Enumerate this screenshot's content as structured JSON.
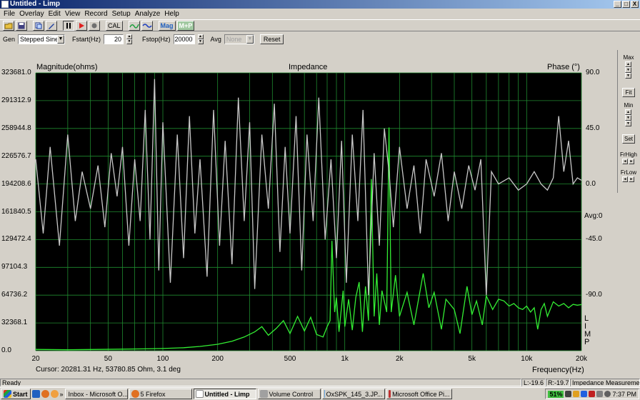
{
  "window": {
    "title": "Untitled - Limp",
    "min": "_",
    "max": "□",
    "close": "X"
  },
  "menu": [
    "File",
    "Overlay",
    "Edit",
    "View",
    "Record",
    "Setup",
    "Analyze",
    "Help"
  ],
  "toolbar": {
    "cal_label": "CAL",
    "mag_label": "Mag",
    "mp_label": "M+P"
  },
  "controls": {
    "gen_label": "Gen",
    "gen_value": "Stepped Sine",
    "fstart_label": "Fstart(Hz)",
    "fstart_value": "20",
    "fstop_label": "Fstop(Hz)",
    "fstop_value": "20000",
    "avg_label": "Avg",
    "avg_value": "None",
    "reset_label": "Reset"
  },
  "plot": {
    "title": "Impedance",
    "left_axis_label": "Magnitude(ohms)",
    "right_axis_label": "Phase (°)",
    "x_axis_label": "Frequency(Hz)",
    "cursor_text": "Cursor: 20281.31 Hz, 53780.85 Ohm, 3.1 deg",
    "avg_text": "Avg:0",
    "side_letters": [
      "L",
      "I",
      "M",
      "P"
    ]
  },
  "chart_data": {
    "type": "line",
    "title": "Impedance",
    "xlabel": "Frequency(Hz)",
    "ylabel": "Magnitude(ohms)",
    "y2label": "Phase (°)",
    "x_scale": "log",
    "xlim": [
      20,
      20000
    ],
    "ylim": [
      0,
      323681
    ],
    "y2lim": [
      -135,
      90
    ],
    "x_ticks": [
      "20",
      "50",
      "100",
      "200",
      "500",
      "1k",
      "2k",
      "5k",
      "10k",
      "20k"
    ],
    "x_tick_values": [
      20,
      50,
      100,
      200,
      500,
      1000,
      2000,
      5000,
      10000,
      20000
    ],
    "y_ticks": [
      "0.0",
      "32368.1",
      "64736.2",
      "97104.3",
      "129472.4",
      "161840.5",
      "194208.6",
      "226576.7",
      "258944.8",
      "291312.9",
      "323681.0"
    ],
    "y2_ticks": [
      "90.0",
      "45.0",
      "0.0",
      "-45.0",
      "-90.0"
    ],
    "y2_tick_values": [
      90,
      45,
      0,
      -45,
      -90
    ],
    "grid": true,
    "background": "#000000",
    "series": [
      {
        "axis": "left",
        "color": "#33ee33",
        "points": [
          [
            20,
            1500
          ],
          [
            30,
            1200
          ],
          [
            40,
            1400
          ],
          [
            60,
            1800
          ],
          [
            80,
            2200
          ],
          [
            100,
            2600
          ],
          [
            130,
            3500
          ],
          [
            160,
            5000
          ],
          [
            200,
            7500
          ],
          [
            240,
            11000
          ],
          [
            280,
            16000
          ],
          [
            320,
            22000
          ],
          [
            350,
            28000
          ],
          [
            380,
            18000
          ],
          [
            420,
            26000
          ],
          [
            460,
            35000
          ],
          [
            500,
            20000
          ],
          [
            550,
            40000
          ],
          [
            600,
            23000
          ],
          [
            650,
            39000
          ],
          [
            700,
            19000
          ],
          [
            760,
            16000
          ],
          [
            800,
            28000
          ],
          [
            830,
            35000
          ],
          [
            850,
            128000
          ],
          [
            880,
            45000
          ],
          [
            900,
            62000
          ],
          [
            930,
            22000
          ],
          [
            980,
            70000
          ],
          [
            1000,
            28000
          ],
          [
            1050,
            60000
          ],
          [
            1100,
            24000
          ],
          [
            1150,
            62000
          ],
          [
            1200,
            80000
          ],
          [
            1250,
            22000
          ],
          [
            1300,
            75000
          ],
          [
            1350,
            35000
          ],
          [
            1400,
            200000
          ],
          [
            1450,
            40000
          ],
          [
            1500,
            90000
          ],
          [
            1550,
            30000
          ],
          [
            1600,
            70000
          ],
          [
            1700,
            45000
          ],
          [
            1750,
            260000
          ],
          [
            1800,
            45000
          ],
          [
            1900,
            88000
          ],
          [
            2000,
            40000
          ],
          [
            2200,
            68000
          ],
          [
            2400,
            30000
          ],
          [
            2700,
            90000
          ],
          [
            2900,
            50000
          ],
          [
            3100,
            68000
          ],
          [
            3400,
            25000
          ],
          [
            3600,
            60000
          ],
          [
            4000,
            48000
          ],
          [
            4300,
            20000
          ],
          [
            4700,
            75000
          ],
          [
            5000,
            42000
          ],
          [
            5300,
            58000
          ],
          [
            5700,
            30000
          ],
          [
            6000,
            64000
          ],
          [
            6500,
            48000
          ],
          [
            7000,
            60000
          ],
          [
            7500,
            58000
          ],
          [
            8000,
            52000
          ],
          [
            8500,
            55000
          ],
          [
            9000,
            50000
          ],
          [
            9500,
            48000
          ],
          [
            10000,
            52000
          ],
          [
            10500,
            45000
          ],
          [
            11000,
            50000
          ],
          [
            11500,
            25000
          ],
          [
            12000,
            48000
          ],
          [
            12500,
            55000
          ],
          [
            13000,
            40000
          ],
          [
            14000,
            57000
          ],
          [
            15000,
            52000
          ],
          [
            16000,
            55000
          ],
          [
            17000,
            50000
          ],
          [
            18000,
            54000
          ],
          [
            19000,
            53000
          ],
          [
            20000,
            53780
          ]
        ]
      },
      {
        "axis": "right",
        "color": "#c8c8c8",
        "points": [
          [
            20,
            20
          ],
          [
            22,
            -40
          ],
          [
            24,
            30
          ],
          [
            27,
            -50
          ],
          [
            30,
            40
          ],
          [
            33,
            -30
          ],
          [
            36,
            10
          ],
          [
            40,
            -20
          ],
          [
            44,
            15
          ],
          [
            48,
            -35
          ],
          [
            52,
            25
          ],
          [
            56,
            -10
          ],
          [
            60,
            30
          ],
          [
            65,
            -50
          ],
          [
            70,
            20
          ],
          [
            75,
            -30
          ],
          [
            80,
            60
          ],
          [
            85,
            -45
          ],
          [
            90,
            85
          ],
          [
            95,
            -70
          ],
          [
            100,
            50
          ],
          [
            110,
            -80
          ],
          [
            120,
            40
          ],
          [
            130,
            -60
          ],
          [
            140,
            55
          ],
          [
            150,
            -40
          ],
          [
            160,
            20
          ],
          [
            175,
            -75
          ],
          [
            190,
            60
          ],
          [
            205,
            -50
          ],
          [
            220,
            35
          ],
          [
            240,
            -65
          ],
          [
            260,
            70
          ],
          [
            280,
            -30
          ],
          [
            300,
            50
          ],
          [
            320,
            -85
          ],
          [
            350,
            40
          ],
          [
            380,
            -20
          ],
          [
            410,
            65
          ],
          [
            440,
            -55
          ],
          [
            470,
            30
          ],
          [
            500,
            -40
          ],
          [
            540,
            55
          ],
          [
            580,
            -70
          ],
          [
            620,
            40
          ],
          [
            670,
            -30
          ],
          [
            720,
            70
          ],
          [
            780,
            -45
          ],
          [
            840,
            20
          ],
          [
            900,
            -60
          ],
          [
            960,
            35
          ],
          [
            1020,
            -80
          ],
          [
            1100,
            40
          ],
          [
            1180,
            -30
          ],
          [
            1260,
            60
          ],
          [
            1350,
            -90
          ],
          [
            1450,
            25
          ],
          [
            1550,
            -50
          ],
          [
            1650,
            45
          ],
          [
            1750,
            10
          ],
          [
            1850,
            -35
          ],
          [
            2000,
            30
          ],
          [
            2200,
            -20
          ],
          [
            2400,
            15
          ],
          [
            2600,
            -40
          ],
          [
            2800,
            20
          ],
          [
            3100,
            -10
          ],
          [
            3400,
            25
          ],
          [
            3700,
            -30
          ],
          [
            4000,
            10
          ],
          [
            4400,
            -20
          ],
          [
            4800,
            15
          ],
          [
            5200,
            -5
          ],
          [
            5600,
            20
          ],
          [
            6000,
            -90
          ],
          [
            6400,
            10
          ],
          [
            7000,
            0
          ],
          [
            8000,
            5
          ],
          [
            9000,
            -5
          ],
          [
            10000,
            0
          ],
          [
            11000,
            10
          ],
          [
            12000,
            0
          ],
          [
            13000,
            -5
          ],
          [
            14000,
            5
          ],
          [
            15000,
            55
          ],
          [
            16000,
            10
          ],
          [
            17000,
            35
          ],
          [
            18000,
            0
          ],
          [
            19000,
            5
          ],
          [
            20000,
            3
          ]
        ]
      }
    ]
  },
  "right_panel": {
    "max_label": "Max",
    "fit_label": "Fit",
    "min_label": "Min",
    "set_label": "Set",
    "frhigh_label": "FrHigh",
    "frlow_label": "FrLow"
  },
  "status": {
    "ready": "Ready",
    "l_val": "L:-19.6",
    "r_val": "R:-19.7",
    "mode": "Impedance Measurement"
  },
  "taskbar": {
    "start_label": "Start",
    "items": [
      {
        "label": "Inbox - Microsoft O...",
        "active": false
      },
      {
        "label": "5 Firefox",
        "active": false
      },
      {
        "label": "Untitled - Limp",
        "active": true
      },
      {
        "label": "Volume Control",
        "active": false
      },
      {
        "label": "OxSPK_145_3.JP...",
        "active": false
      },
      {
        "label": "Microsoft Office Pi...",
        "active": false
      }
    ],
    "battery": "51%",
    "clock": "7:37 PM",
    "quicklaunch_more": "»"
  }
}
